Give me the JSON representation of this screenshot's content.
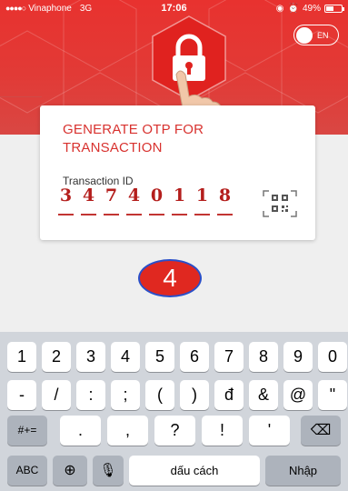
{
  "status_bar": {
    "carrier": "Vinaphone",
    "network": "3G",
    "time": "17:06",
    "battery": "49%",
    "battery_level": 0.49
  },
  "language_toggle": {
    "label": "EN"
  },
  "card": {
    "title": "GENERATE OTP FOR TRANSACTION",
    "transaction_label": "Transaction ID",
    "transaction_digits": [
      "3",
      "4",
      "7",
      "4",
      "0",
      "1",
      "1",
      "8"
    ]
  },
  "step_badge": "4",
  "keyboard": {
    "row1": [
      "1",
      "2",
      "3",
      "4",
      "5",
      "6",
      "7",
      "8",
      "9",
      "0"
    ],
    "row2": [
      "-",
      "/",
      ":",
      ";",
      "(",
      ")",
      "đ",
      "&",
      "@",
      "\""
    ],
    "row3_left": "#+=",
    "row3_keys": [
      ".",
      ",",
      "?",
      "!",
      "'"
    ],
    "row4_left": "ABC",
    "space_label": "dấu cách",
    "return_label": "Nhập"
  },
  "colors": {
    "brand_red": "#e8322f",
    "keyboard_bg": "#d1d5db",
    "badge_border": "#2a4fc8"
  }
}
